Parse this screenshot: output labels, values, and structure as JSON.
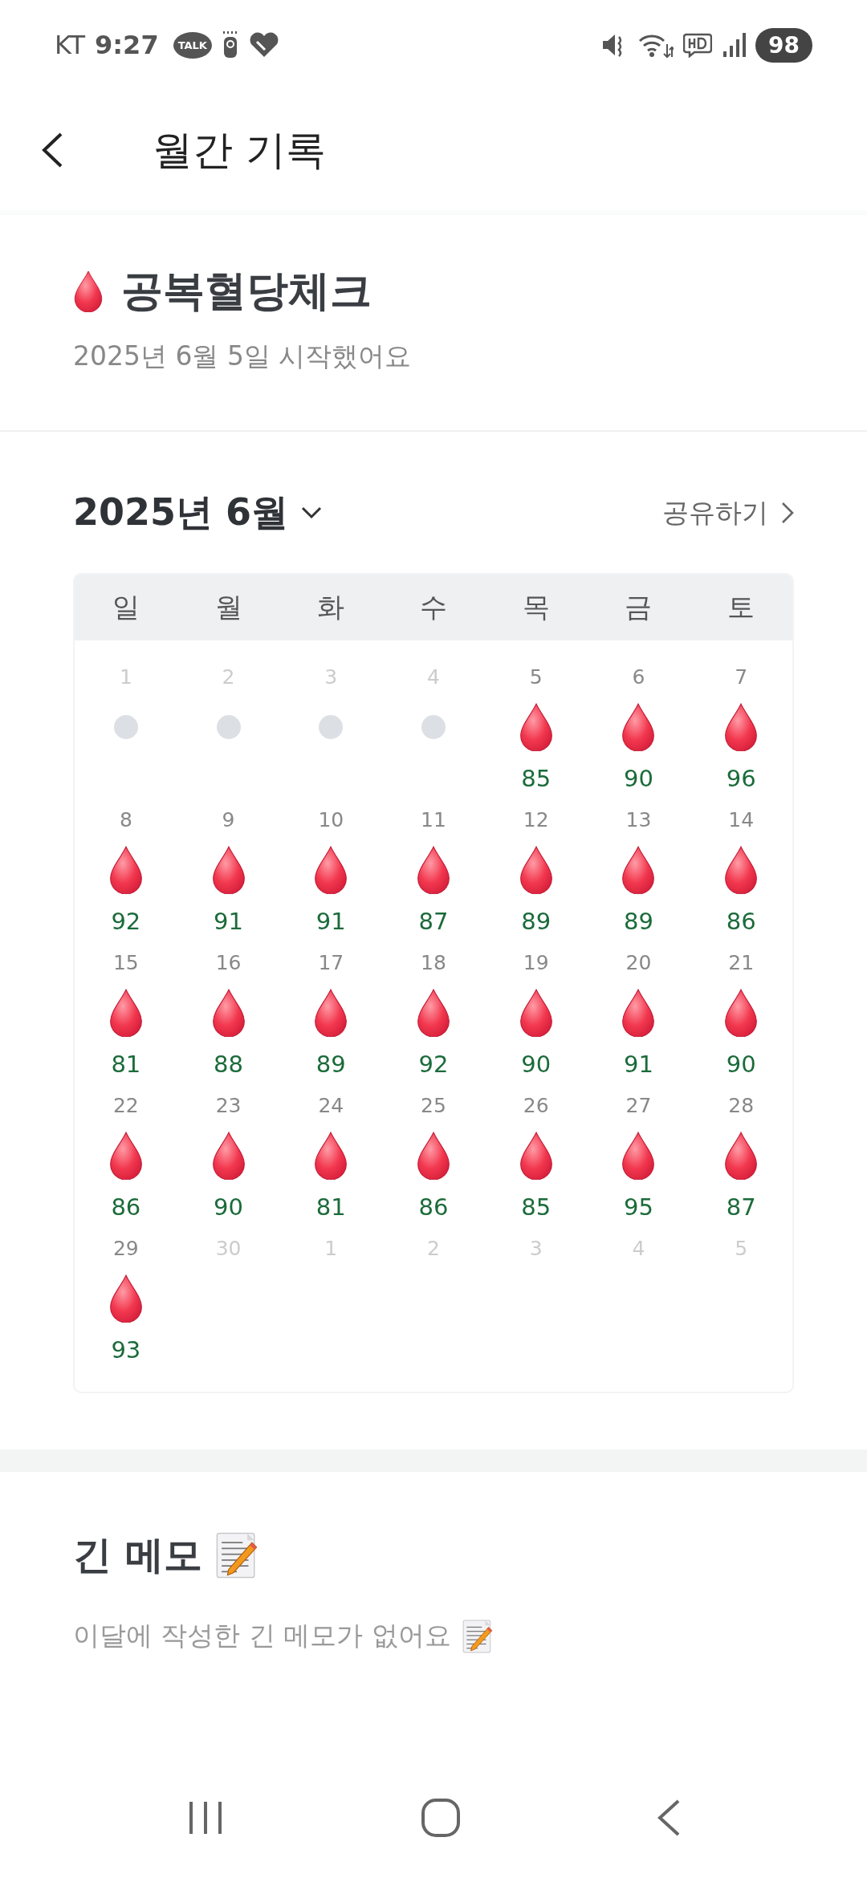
{
  "status_bar": {
    "carrier": "KT",
    "time": "9:27",
    "talk_badge": "TALK",
    "battery": "98"
  },
  "header": {
    "title": "월간 기록"
  },
  "habit": {
    "title": "공복혈당체크",
    "subtitle": "2025년 6월 5일 시작했어요"
  },
  "calendar": {
    "month": "2025년 6월",
    "share": "공유하기",
    "weekdays": [
      "일",
      "월",
      "화",
      "수",
      "목",
      "금",
      "토"
    ],
    "days": [
      {
        "number": "1",
        "faded": true,
        "kind": "pending"
      },
      {
        "number": "2",
        "faded": true,
        "kind": "pending"
      },
      {
        "number": "3",
        "faded": true,
        "kind": "pending"
      },
      {
        "number": "4",
        "faded": true,
        "kind": "pending"
      },
      {
        "number": "5",
        "faded": false,
        "kind": "record",
        "value": "85"
      },
      {
        "number": "6",
        "faded": false,
        "kind": "record",
        "value": "90"
      },
      {
        "number": "7",
        "faded": false,
        "kind": "record",
        "value": "96"
      },
      {
        "number": "8",
        "faded": false,
        "kind": "record",
        "value": "92"
      },
      {
        "number": "9",
        "faded": false,
        "kind": "record",
        "value": "91"
      },
      {
        "number": "10",
        "faded": false,
        "kind": "record",
        "value": "91"
      },
      {
        "number": "11",
        "faded": false,
        "kind": "record",
        "value": "87"
      },
      {
        "number": "12",
        "faded": false,
        "kind": "record",
        "value": "89"
      },
      {
        "number": "13",
        "faded": false,
        "kind": "record",
        "value": "89"
      },
      {
        "number": "14",
        "faded": false,
        "kind": "record",
        "value": "86"
      },
      {
        "number": "15",
        "faded": false,
        "kind": "record",
        "value": "81"
      },
      {
        "number": "16",
        "faded": false,
        "kind": "record",
        "value": "88"
      },
      {
        "number": "17",
        "faded": false,
        "kind": "record",
        "value": "89"
      },
      {
        "number": "18",
        "faded": false,
        "kind": "record",
        "value": "92"
      },
      {
        "number": "19",
        "faded": false,
        "kind": "record",
        "value": "90"
      },
      {
        "number": "20",
        "faded": false,
        "kind": "record",
        "value": "91"
      },
      {
        "number": "21",
        "faded": false,
        "kind": "record",
        "value": "90"
      },
      {
        "number": "22",
        "faded": false,
        "kind": "record",
        "value": "86"
      },
      {
        "number": "23",
        "faded": false,
        "kind": "record",
        "value": "90"
      },
      {
        "number": "24",
        "faded": false,
        "kind": "record",
        "value": "81"
      },
      {
        "number": "25",
        "faded": false,
        "kind": "record",
        "value": "86"
      },
      {
        "number": "26",
        "faded": false,
        "kind": "record",
        "value": "85"
      },
      {
        "number": "27",
        "faded": false,
        "kind": "record",
        "value": "95"
      },
      {
        "number": "28",
        "faded": false,
        "kind": "record",
        "value": "87"
      },
      {
        "number": "29",
        "faded": false,
        "kind": "record",
        "value": "93"
      },
      {
        "number": "30",
        "faded": true,
        "kind": "none"
      },
      {
        "number": "1",
        "faded": true,
        "kind": "none"
      },
      {
        "number": "2",
        "faded": true,
        "kind": "none"
      },
      {
        "number": "3",
        "faded": true,
        "kind": "none"
      },
      {
        "number": "4",
        "faded": true,
        "kind": "none"
      },
      {
        "number": "5",
        "faded": true,
        "kind": "none"
      }
    ]
  },
  "memo": {
    "title": "긴 메모",
    "empty_text": "이달에 작성한 긴 메모가 없어요"
  }
}
